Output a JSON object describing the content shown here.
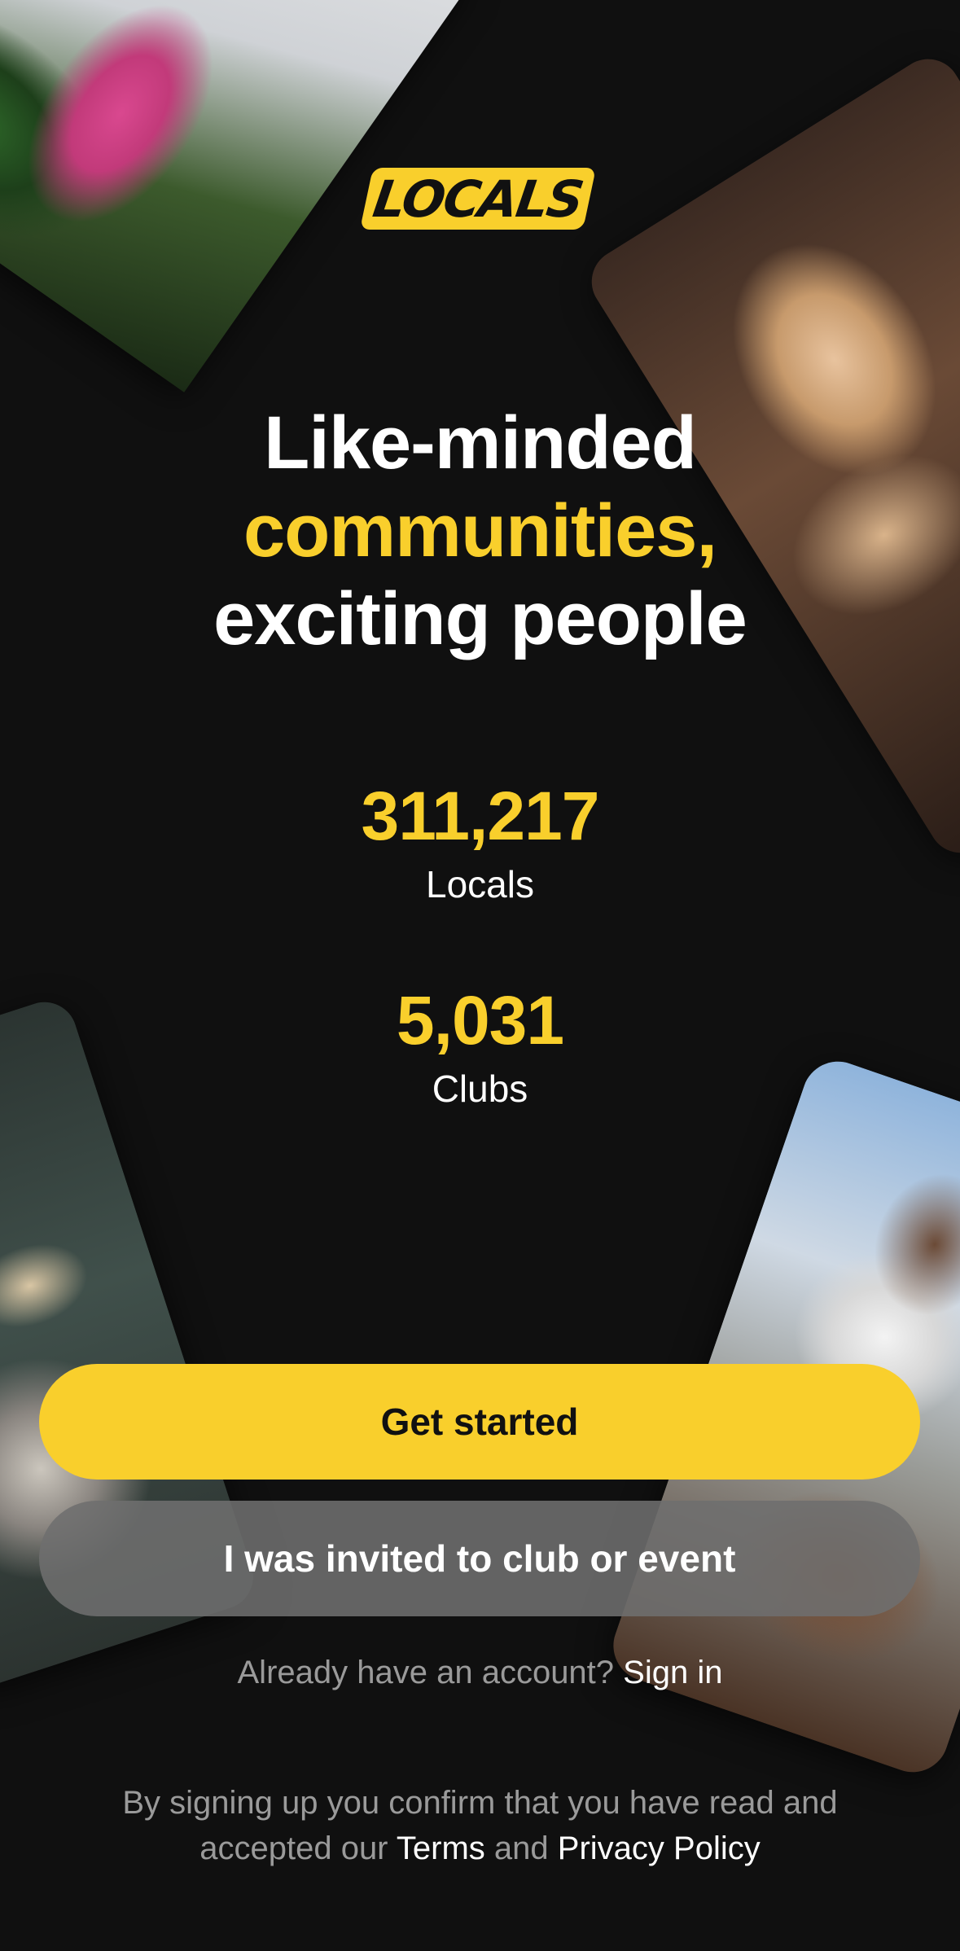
{
  "logo": {
    "text": "LOCALS"
  },
  "headline": {
    "line1": "Like-minded",
    "line2": "communities,",
    "line3": "exciting people"
  },
  "stats": {
    "locals": {
      "value": "311,217",
      "label": "Locals"
    },
    "clubs": {
      "value": "5,031",
      "label": "Clubs"
    }
  },
  "buttons": {
    "get_started": "Get started",
    "invited": "I was invited to club or event"
  },
  "signin": {
    "prompt": "Already have an account?",
    "link": "Sign in"
  },
  "legal": {
    "text_before": "By signing up you confirm that you have read and accepted our",
    "terms": "Terms",
    "and": "and",
    "privacy": "Privacy Policy"
  },
  "colors": {
    "accent": "#f9cf2c",
    "background": "#101010",
    "secondary_button": "#6e6e6e",
    "muted_text": "#9a9a9a"
  }
}
